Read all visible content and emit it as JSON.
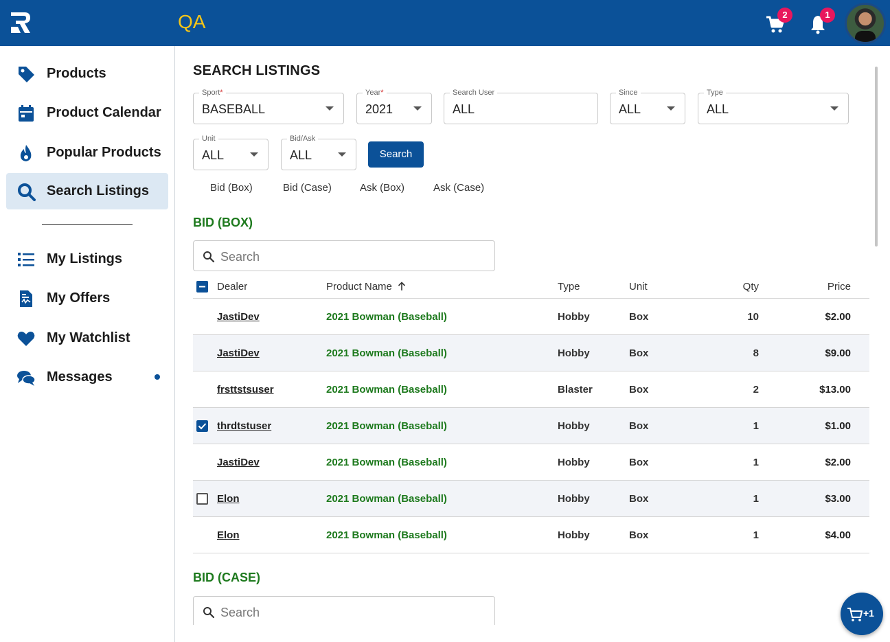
{
  "header": {
    "env_label": "QA",
    "cart_count": "2",
    "notification_count": "1"
  },
  "sidebar": {
    "items": [
      {
        "label": "Products",
        "icon": "tag-icon"
      },
      {
        "label": "Product Calendar",
        "icon": "calendar-icon"
      },
      {
        "label": "Popular Products",
        "icon": "flame-icon"
      },
      {
        "label": "Search Listings",
        "icon": "search-icon"
      },
      {
        "label": "My Listings",
        "icon": "list-icon"
      },
      {
        "label": "My Offers",
        "icon": "document-icon"
      },
      {
        "label": "My Watchlist",
        "icon": "heart-icon"
      },
      {
        "label": "Messages",
        "icon": "chat-icon"
      }
    ]
  },
  "search": {
    "title": "SEARCH LISTINGS",
    "sport": {
      "label": "Sport",
      "value": "BASEBALL"
    },
    "year": {
      "label": "Year",
      "value": "2021"
    },
    "user": {
      "label": "Search User",
      "value": "ALL"
    },
    "since": {
      "label": "Since",
      "value": "ALL"
    },
    "type": {
      "label": "Type",
      "value": "ALL"
    },
    "unit": {
      "label": "Unit",
      "value": "ALL"
    },
    "bidask": {
      "label": "Bid/Ask",
      "value": "ALL"
    },
    "button": "Search",
    "tabs": [
      "Bid (Box)",
      "Bid (Case)",
      "Ask (Box)",
      "Ask (Case)"
    ]
  },
  "bid_box": {
    "title": "BID (BOX)",
    "search_placeholder": "Search",
    "columns": [
      "Dealer",
      "Product Name",
      "Type",
      "Unit",
      "Qty",
      "Price"
    ],
    "rows": [
      {
        "dealer": "JastiDev",
        "product": "2021 Bowman (Baseball)",
        "type": "Hobby",
        "unit": "Box",
        "qty": "10",
        "price": "$2.00",
        "checkbox": "none"
      },
      {
        "dealer": "JastiDev",
        "product": "2021 Bowman (Baseball)",
        "type": "Hobby",
        "unit": "Box",
        "qty": "8",
        "price": "$9.00",
        "checkbox": "none"
      },
      {
        "dealer": "frsttstsuser",
        "product": "2021 Bowman (Baseball)",
        "type": "Blaster",
        "unit": "Box",
        "qty": "2",
        "price": "$13.00",
        "checkbox": "none"
      },
      {
        "dealer": "thrdtstuser",
        "product": "2021 Bowman (Baseball)",
        "type": "Hobby",
        "unit": "Box",
        "qty": "1",
        "price": "$1.00",
        "checkbox": "checked"
      },
      {
        "dealer": "JastiDev",
        "product": "2021 Bowman (Baseball)",
        "type": "Hobby",
        "unit": "Box",
        "qty": "1",
        "price": "$2.00",
        "checkbox": "none"
      },
      {
        "dealer": "Elon",
        "product": "2021 Bowman (Baseball)",
        "type": "Hobby",
        "unit": "Box",
        "qty": "1",
        "price": "$3.00",
        "checkbox": "empty"
      },
      {
        "dealer": "Elon",
        "product": "2021 Bowman (Baseball)",
        "type": "Hobby",
        "unit": "Box",
        "qty": "1",
        "price": "$4.00",
        "checkbox": "none"
      }
    ]
  },
  "bid_case": {
    "title": "BID (CASE)",
    "search_placeholder": "Search"
  },
  "fab": {
    "label": "+1"
  },
  "colors": {
    "primary": "#0b5198",
    "accent_green": "#1e7a1e",
    "badge": "#e8175d",
    "env_label": "#f5c518"
  }
}
